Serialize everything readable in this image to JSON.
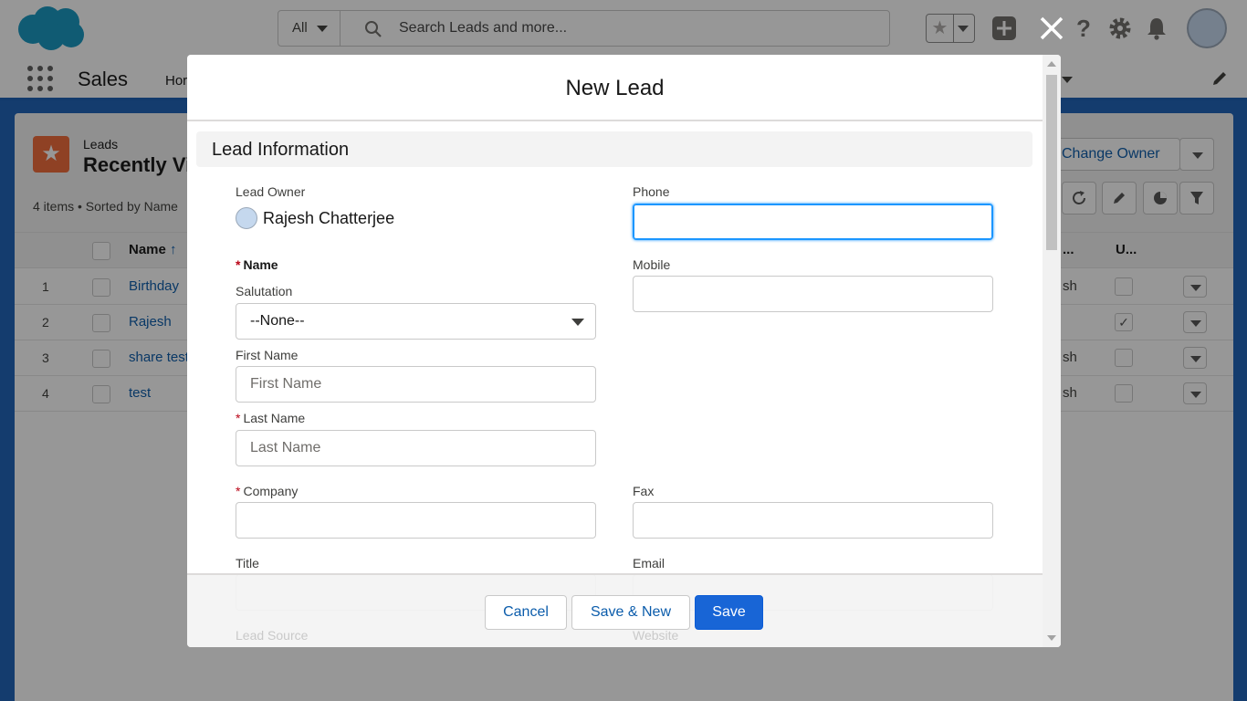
{
  "header": {
    "search_scope": "All",
    "search_placeholder": "Search Leads and more..."
  },
  "nav": {
    "app_name": "Sales",
    "home_partial": "Hor"
  },
  "list_view": {
    "object_label": "Leads",
    "view_title": "Recently Viewed",
    "meta": "4 items • Sorted by Name",
    "change_owner_label": "Change Owner",
    "column_name": "Name",
    "column_name_sort": "↑",
    "column_owner_partial": "...",
    "column_unread_partial": "U...",
    "rows": [
      {
        "num": "1",
        "name": "Birthday",
        "owner_partial": "sh",
        "unread": false
      },
      {
        "num": "2",
        "name": "Rajesh",
        "owner_partial": "",
        "unread": true
      },
      {
        "num": "3",
        "name": "share test",
        "owner_partial": "sh",
        "unread": false
      },
      {
        "num": "4",
        "name": "test",
        "owner_partial": "sh",
        "unread": false
      }
    ]
  },
  "modal": {
    "title": "New Lead",
    "section_title": "Lead Information",
    "fields": {
      "lead_owner_label": "Lead Owner",
      "lead_owner_value": "Rajesh Chatterjee",
      "phone_label": "Phone",
      "phone_value": "",
      "name_label": "Name",
      "mobile_label": "Mobile",
      "mobile_value": "",
      "salutation_label": "Salutation",
      "salutation_value": "--None--",
      "first_name_label": "First Name",
      "first_name_placeholder": "First Name",
      "last_name_label": "Last Name",
      "last_name_placeholder": "Last Name",
      "company_label": "Company",
      "company_value": "",
      "fax_label": "Fax",
      "fax_value": "",
      "title_label": "Title",
      "email_label": "Email",
      "lead_source_label": "Lead Source",
      "website_label": "Website"
    },
    "required_mark": "*",
    "buttons": {
      "cancel": "Cancel",
      "save_new": "Save & New",
      "save": "Save"
    }
  },
  "colors": {
    "brand_blue": "#0b5cab",
    "primary_button": "#1865d6",
    "focus_ring": "#1b96ff",
    "leads_icon": "#f26b3a",
    "required": "#ba0517"
  },
  "icons": {
    "logo": "salesforce-cloud-icon",
    "close": "close-icon",
    "search": "search-icon",
    "favorites": "star-icon",
    "add": "plus-icon",
    "help": "question-icon",
    "setup": "gear-icon",
    "notifications": "bell-icon"
  }
}
